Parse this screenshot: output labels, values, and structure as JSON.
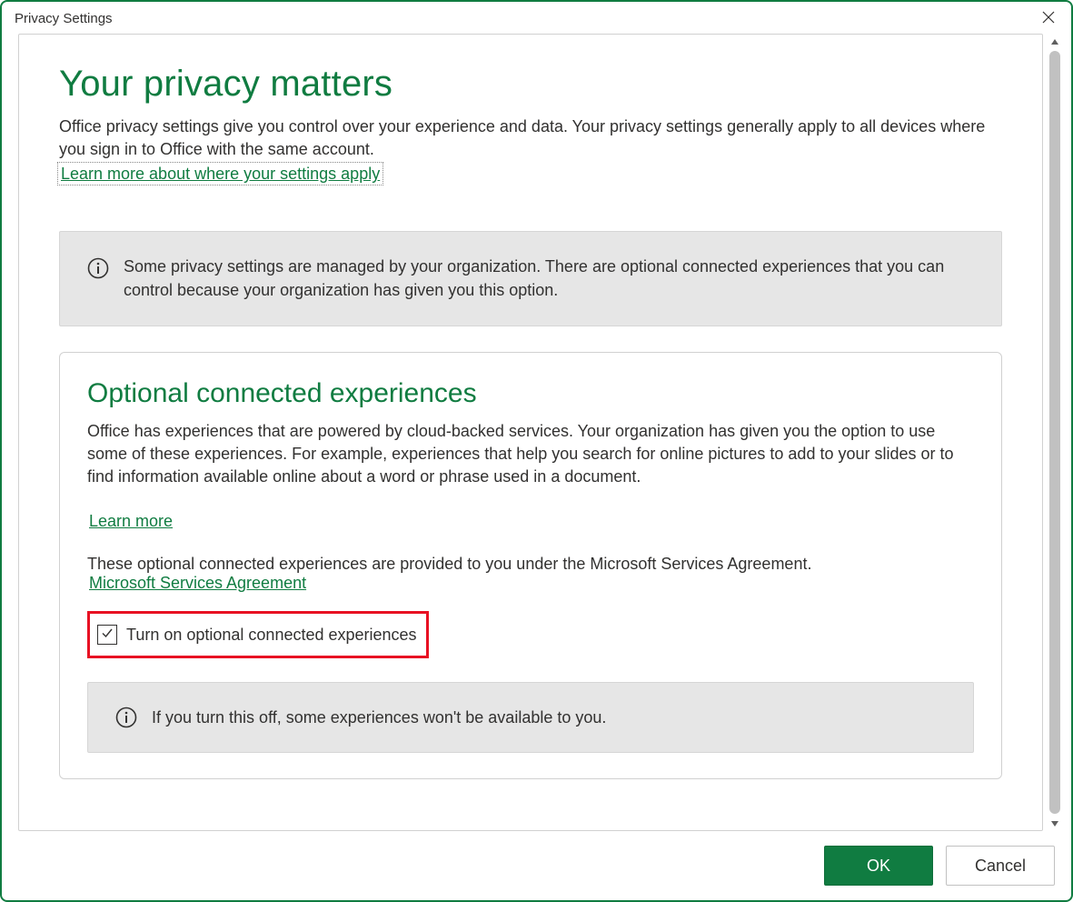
{
  "dialog": {
    "title": "Privacy Settings"
  },
  "main": {
    "heading": "Your privacy matters",
    "intro": "Office privacy settings give you control over your experience and data. Your privacy settings generally apply to all devices where you sign in to Office with the same account.",
    "intro_link": "Learn more about where your settings apply",
    "org_notice": "Some privacy settings are managed by your organization. There are optional connected experiences that you can control because your organization has given you this option."
  },
  "card": {
    "heading": "Optional connected experiences",
    "body": "Office has experiences that are powered by cloud-backed services. Your organization has given you the option to use some of these experiences. For example, experiences that help you search for online pictures to add to your slides or to find information available online about a word or phrase used in a document.",
    "learn_more": "Learn more",
    "provided_text": "These optional connected experiences are provided to you under the Microsoft Services Agreement.",
    "msa_link": "Microsoft Services Agreement",
    "checkbox_label": "Turn on optional connected experiences",
    "checkbox_checked": true,
    "off_notice": "If you turn this off, some experiences won't be available to you."
  },
  "footer": {
    "ok": "OK",
    "cancel": "Cancel"
  }
}
